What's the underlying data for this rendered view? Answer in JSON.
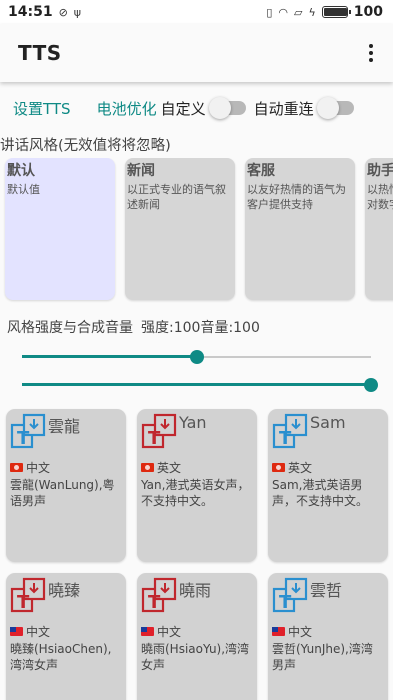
{
  "status_bar": {
    "time": "14:51",
    "battery": "100",
    "battery_level": 1.0
  },
  "app_bar": {
    "title": "TTS"
  },
  "top_row": {
    "settings_link": "设置TTS",
    "battery_link": "电池优化",
    "custom_label": "自定义",
    "custom_on": false,
    "reconnect_label": "自动重连",
    "reconnect_on": false
  },
  "styles_section": {
    "label": "讲话风格(无效值将将忽略)",
    "items": [
      {
        "name": "默认",
        "desc": "默认值",
        "selected": true
      },
      {
        "name": "新闻",
        "desc": "以正式专业的语气叙述新闻",
        "selected": false
      },
      {
        "name": "客服",
        "desc": "以友好热情的语气为客户提供支持",
        "selected": false
      },
      {
        "name": "助手",
        "desc": "以热情而轻松的语气对数字",
        "selected": false
      }
    ]
  },
  "strength": {
    "label": "风格强度与合成音量",
    "values": "强度:100音量:100",
    "strength_fraction": 0.5,
    "volume_fraction": 1.0
  },
  "colors": {
    "accent": "#0f8a85",
    "icon_red": "#c0272d",
    "icon_blue": "#2a8fcf"
  },
  "voices": [
    {
      "name": "雲龍",
      "flag": "hk",
      "lang": "中文",
      "desc": "雲龍(WanLung),粤语男声",
      "icon": "tts-voice-icon-blue"
    },
    {
      "name": "Yan",
      "flag": "hk",
      "lang": "英文",
      "desc": "Yan,港式英语女声，不支持中文。",
      "icon": "tts-voice-icon-red"
    },
    {
      "name": "Sam",
      "flag": "hk",
      "lang": "英文",
      "desc": "Sam,港式英语男声，不支持中文。",
      "icon": "tts-voice-icon-blue"
    },
    {
      "name": "曉臻",
      "flag": "tw",
      "lang": "中文",
      "desc": "曉臻(HsiaoChen),湾湾女声",
      "icon": "tts-voice-icon-red"
    },
    {
      "name": "曉雨",
      "flag": "tw",
      "lang": "中文",
      "desc": "曉雨(HsiaoYu),湾湾女声",
      "icon": "tts-voice-icon-red"
    },
    {
      "name": "雲哲",
      "flag": "tw",
      "lang": "中文",
      "desc": "雲哲(YunJhe),湾湾男声",
      "icon": "tts-voice-icon-blue"
    }
  ]
}
